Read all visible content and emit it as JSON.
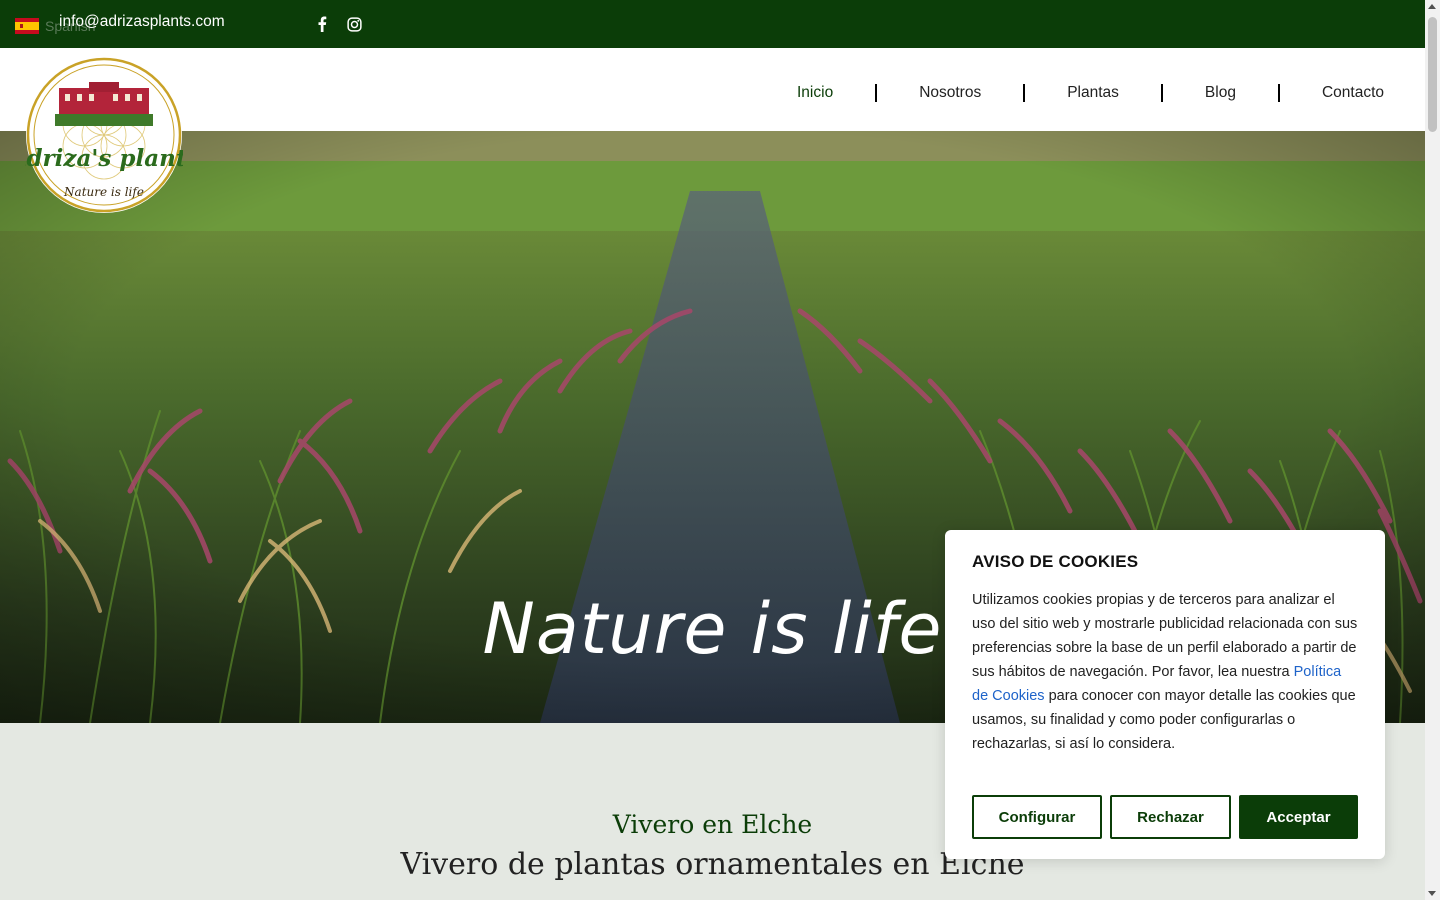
{
  "topbar": {
    "language": "Spanish",
    "email": "info@adrizasplants.com",
    "social": [
      {
        "icon": "facebook-icon"
      },
      {
        "icon": "instagram-icon"
      }
    ]
  },
  "logo": {
    "brand": "Adriza's plants",
    "slogan": "Nature is life"
  },
  "nav": {
    "items": [
      {
        "label": "Inicio",
        "active": true
      },
      {
        "label": "Nosotros",
        "active": false
      },
      {
        "label": "Plantas",
        "active": false
      },
      {
        "label": "Blog",
        "active": false
      },
      {
        "label": "Contacto",
        "active": false
      }
    ]
  },
  "hero": {
    "tagline": "Nature is life"
  },
  "intro": {
    "subtitle": "Vivero en Elche",
    "title": "Vivero de plantas ornamentales en Elche"
  },
  "cookie": {
    "title": "AVISO DE COOKIES",
    "text_before": "Utilizamos cookies propias y de terceros para analizar el uso del sitio web y mostrarle publicidad relacionada con sus preferencias sobre la base de un perfil elaborado a partir de sus hábitos de navegación. Por favor, lea nuestra ",
    "link": "Política de Cookies",
    "text_after": " para conocer con mayor detalle las cookies que usamos, su finalidad y como poder configurarlas o rechazarlas, si así lo considera.",
    "buttons": {
      "configure": "Configurar",
      "reject": "Rechazar",
      "accept": "Acceptar"
    }
  },
  "colors": {
    "brand_green": "#0b3d08",
    "link_blue": "#1e63c9",
    "section_bg": "#e4e8e2"
  }
}
